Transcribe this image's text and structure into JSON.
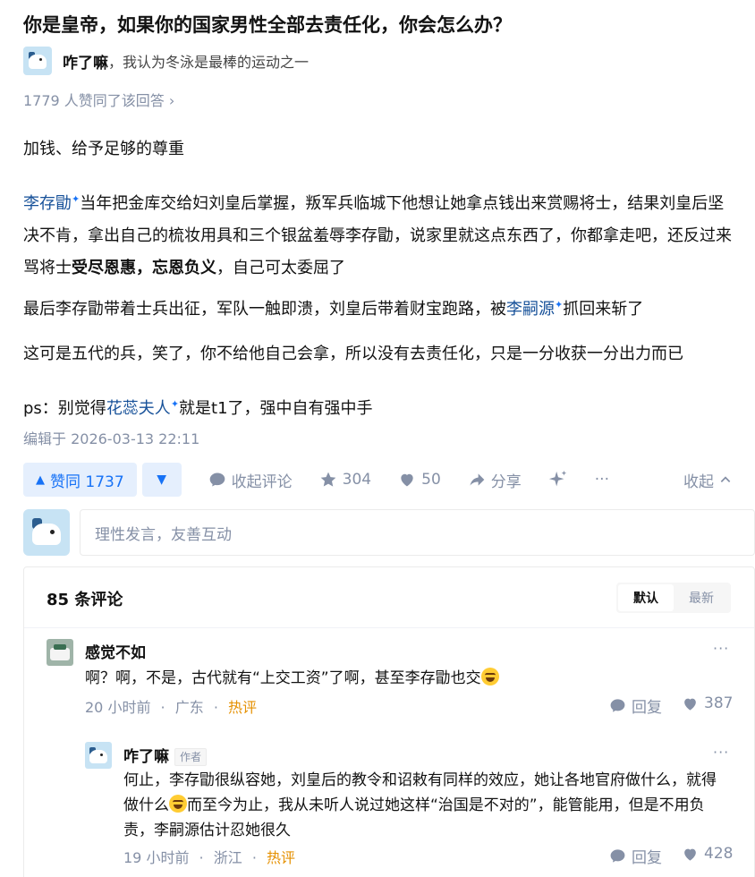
{
  "question": {
    "title": "你是皇帝，如果你的国家男性全部去责任化，你会怎么办？"
  },
  "author": {
    "name": "咋了嘛",
    "separator": "，",
    "bio": "我认为冬泳是最棒的运动之一"
  },
  "answer": {
    "votes_line": "1779 人赞同了该回答 ›",
    "p1": "加钱、给予足够的尊重",
    "p2_link1": "李存勖",
    "p2_text1": "当年把金库交给妇刘皇后掌握，叛军兵临城下他想让她拿点钱出来赏赐将士，结果刘皇后坚决不肯，拿出自己的梳妆用具和三个银盆羞辱李存勖，说家里就这点东西了，你都拿走吧，还反过来骂将士",
    "p2_bold1": "受尽恩惠",
    "p2_sep": "，",
    "p2_bold2": "忘恩负义",
    "p2_text2": "，自己可太委屈了",
    "p3_text1": "最后李存勖带着士兵出征，军队一触即溃，刘皇后带着财宝跑路，被",
    "p3_link": "李嗣源",
    "p3_text2": "抓回来斩了",
    "p4": "这可是五代的兵，笑了，你不给他自己会拿，所以没有去责任化，只是一分收获一分出力而已",
    "p5_text1": "ps：别觉得",
    "p5_link": "花蕊夫人",
    "p5_text2": "就是t1了，强中自有强中手",
    "edited": "编辑于 2026-03-13 22:11",
    "sparkle": "✦"
  },
  "actions": {
    "upvote": "赞同 1737",
    "downvote": "▼",
    "upvote_arrow": "▲",
    "comments": "收起评论",
    "favorites": "304",
    "likes": "50",
    "share": "分享",
    "more": "···",
    "collapse": "收起"
  },
  "comment_input": {
    "placeholder": "理性发言，友善互动"
  },
  "comments": {
    "count": "85 条评论",
    "sort_default": "默认",
    "sort_latest": "最新",
    "items": [
      {
        "user": "感觉不如",
        "text": "啊？啊，不是，古代就有“上交工资”了啊，甚至李存勖也交",
        "time": "20 小时前",
        "dot": "·",
        "location": "广东",
        "hot": "热评",
        "reply": "回复",
        "likes": "387",
        "more": "···"
      },
      {
        "user": "咋了嘛",
        "tag": "作者",
        "text1": "何止，李存勖很纵容她，刘皇后的教令和诏敕有同样的效应，她让各地官府做什么，就得做什么",
        "text2": "而至今为止，我从未听人说过她这样“治国是不对的”，能管能用，但是不用负责，李嗣源估计忍她很久",
        "time": "19 小时前",
        "dot": "·",
        "location": "浙江",
        "hot": "热评",
        "reply": "回复",
        "likes": "428",
        "more": "···"
      }
    ]
  }
}
